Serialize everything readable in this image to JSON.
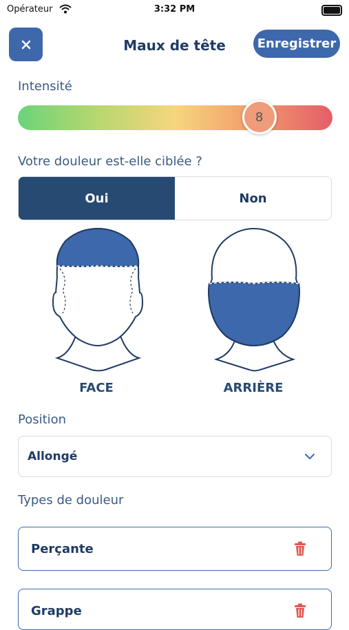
{
  "status_bar": {
    "carrier": "Opérateur",
    "time": "3:32 PM"
  },
  "header": {
    "title": "Maux de tête",
    "save_label": "Enregistrer",
    "close_icon": "close-icon"
  },
  "intensity": {
    "label": "Intensité",
    "value": "8",
    "min": 0,
    "max": 10,
    "level": 0.8
  },
  "targeted": {
    "question": "Votre douleur est-elle ciblée ?",
    "options": [
      "Oui",
      "Non"
    ],
    "selected": "Oui"
  },
  "heads": {
    "front_label": "FACE",
    "back_label": "ARRIÈRE",
    "highlight_color": "#3d68ab"
  },
  "position": {
    "label": "Position",
    "value": "Allongé"
  },
  "pain_types": {
    "label": "Types de douleur",
    "items": [
      {
        "name": "Perçante"
      },
      {
        "name": "Grappe"
      }
    ]
  },
  "colors": {
    "primary": "#3d68ab",
    "dark": "#274a72",
    "delete": "#e5564f"
  }
}
